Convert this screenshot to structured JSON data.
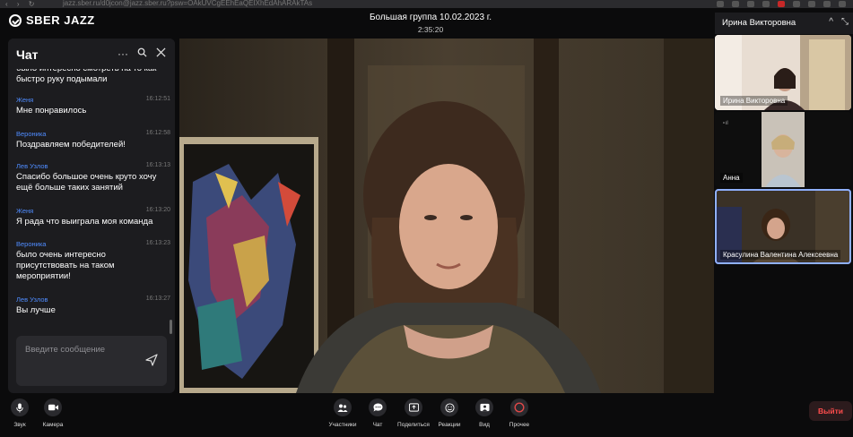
{
  "browser": {
    "url": "jazz.sber.ru/d0jcon@jazz.sber.ru?psw=OAkUVCgEEhEaQEIXhEdAhARAkTAs"
  },
  "app": {
    "logo_text": "SBER JAZZ"
  },
  "meeting": {
    "title": "Большая группа 10.02.2023 г.",
    "timer": "2:35:20"
  },
  "speaker": {
    "name": "Ирина Викторовна"
  },
  "chat": {
    "title": "Чат",
    "partial_top": "было интересно смотреть на то как быстро руку подымали",
    "messages": [
      {
        "author": "Женя",
        "time": "16:12:51",
        "text": "Мне понравилось"
      },
      {
        "author": "Вероника",
        "time": "16:12:58",
        "text": "Поздравляем победителей!"
      },
      {
        "author": "Лев Узлов",
        "time": "16:13:13",
        "text": "Спасибо большое очень круто хочу ещё больше таких занятий"
      },
      {
        "author": "Женя",
        "time": "16:13:20",
        "text": "Я рада что выиграла моя команда"
      },
      {
        "author": "Вероника",
        "time": "16:13:23",
        "text": "было очень интересно присутствовать на таком мероприятии!"
      },
      {
        "author": "Лев Узлов",
        "time": "16:13:27",
        "text": "Вы лучше"
      }
    ],
    "input_placeholder": "Введите сообщение"
  },
  "participants": [
    {
      "name": "Ирина Викторовна"
    },
    {
      "name": "Анна"
    },
    {
      "name": "Красулина Валентина Алексеевна"
    }
  ],
  "controls": {
    "left": [
      {
        "label": "Звук",
        "icon": "microphone-icon"
      },
      {
        "label": "Камера",
        "icon": "camera-icon"
      }
    ],
    "center": [
      {
        "label": "Участники",
        "icon": "participants-icon"
      },
      {
        "label": "Чат",
        "icon": "chat-icon"
      },
      {
        "label": "Поделиться",
        "icon": "share-screen-icon"
      },
      {
        "label": "Реакции",
        "icon": "smile-icon"
      },
      {
        "label": "Вид",
        "icon": "layout-icon"
      },
      {
        "label": "Прочее",
        "icon": "more-icon"
      }
    ],
    "leave": "Выйти"
  },
  "colors": {
    "accent": "#4f8cff",
    "leave": "#ff4d4d",
    "panel": "#1c1c1f",
    "selection": "#8fb0ff"
  }
}
